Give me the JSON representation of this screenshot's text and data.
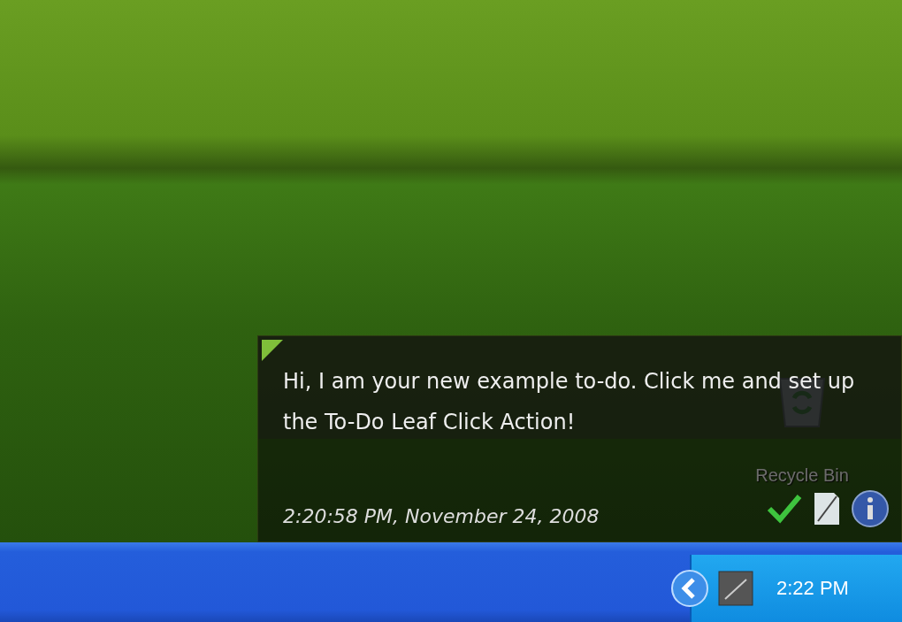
{
  "desktop": {
    "icons": [
      {
        "label": "Recycle Bin"
      }
    ]
  },
  "todo_popup": {
    "text": "Hi, I am your new example to-do. Click me and set up the To-Do Leaf Click Action!",
    "timestamp": "2:20:58 PM, November 24, 2008",
    "actions": [
      {
        "kind": "done"
      },
      {
        "kind": "edit"
      },
      {
        "kind": "info"
      }
    ]
  },
  "taskbar": {
    "clock": "2:22 PM"
  }
}
